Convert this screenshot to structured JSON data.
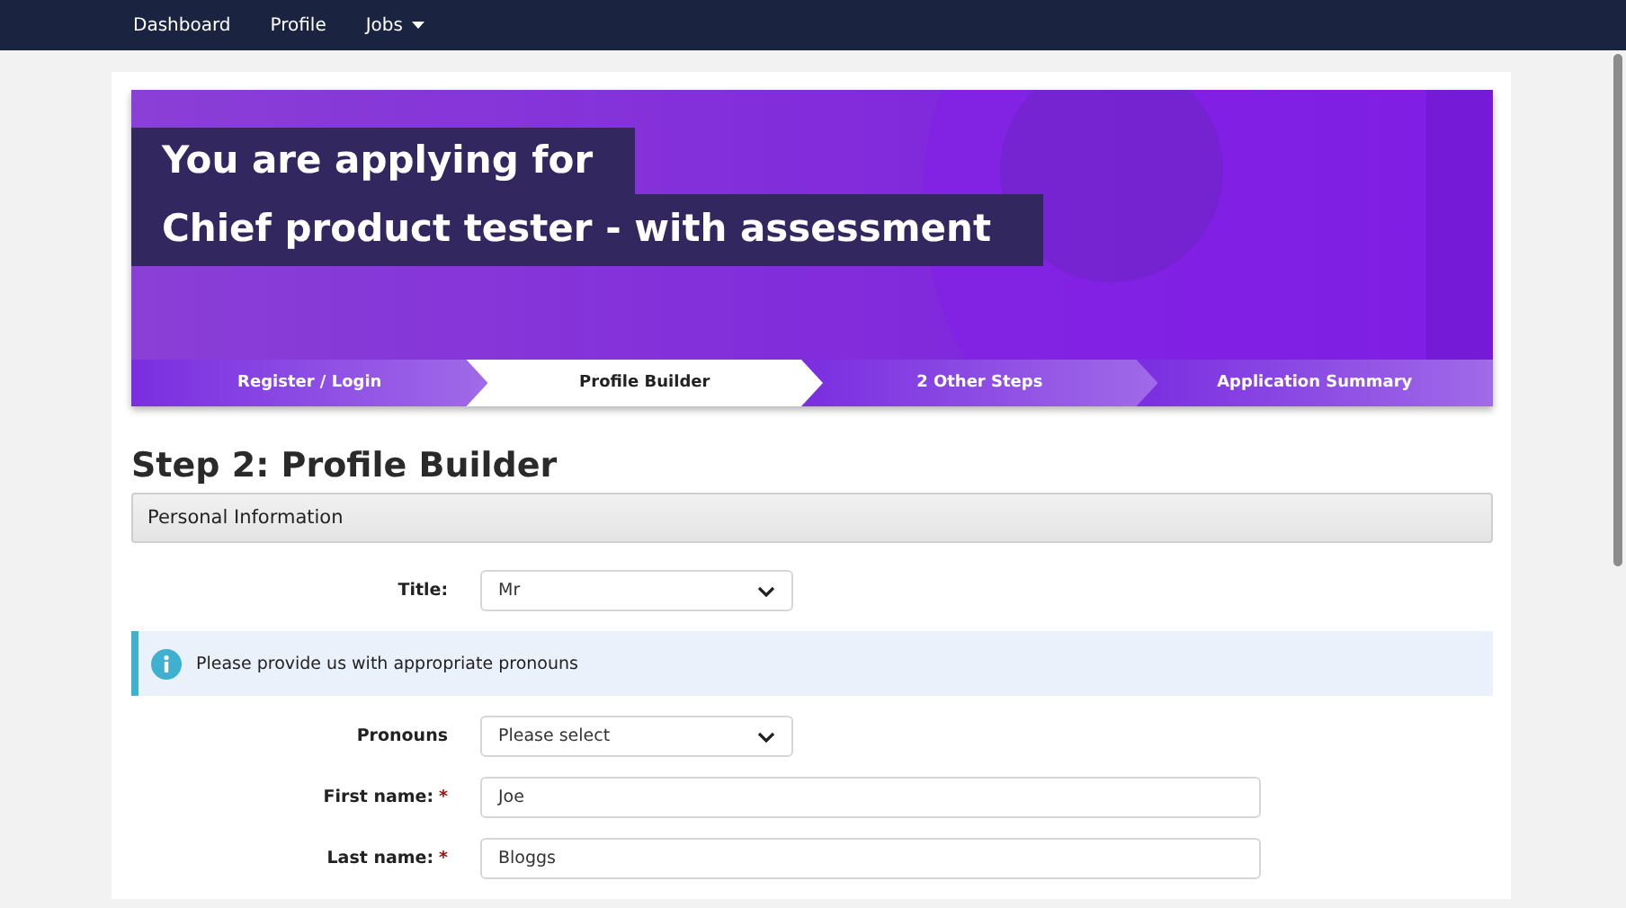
{
  "nav": {
    "items": [
      {
        "label": "Dashboard",
        "dropdown": false
      },
      {
        "label": "Profile",
        "dropdown": false
      },
      {
        "label": "Jobs",
        "dropdown": true
      }
    ]
  },
  "banner": {
    "lead": "You are applying for",
    "job_title": "Chief product tester - with assessment"
  },
  "steps": [
    {
      "label": "Register / Login",
      "selected": false
    },
    {
      "label": "Profile Builder",
      "selected": true
    },
    {
      "label": "2 Other Steps",
      "selected": false
    },
    {
      "label": "Application Summary",
      "selected": false
    }
  ],
  "heading": "Step 2: Profile Builder",
  "section": "Personal Information",
  "fields": [
    {
      "kind": "select",
      "label": "Title:",
      "value": "Mr"
    },
    {
      "kind": "info",
      "text": "Please provide us with appropriate pronouns"
    },
    {
      "kind": "select",
      "label": "Pronouns",
      "value": "Please select"
    },
    {
      "kind": "text",
      "label": "First name:",
      "required_mark": "*",
      "value": "Joe"
    },
    {
      "kind": "text",
      "label": "Last name:",
      "required_mark": "*",
      "value": "Bloggs"
    }
  ]
}
